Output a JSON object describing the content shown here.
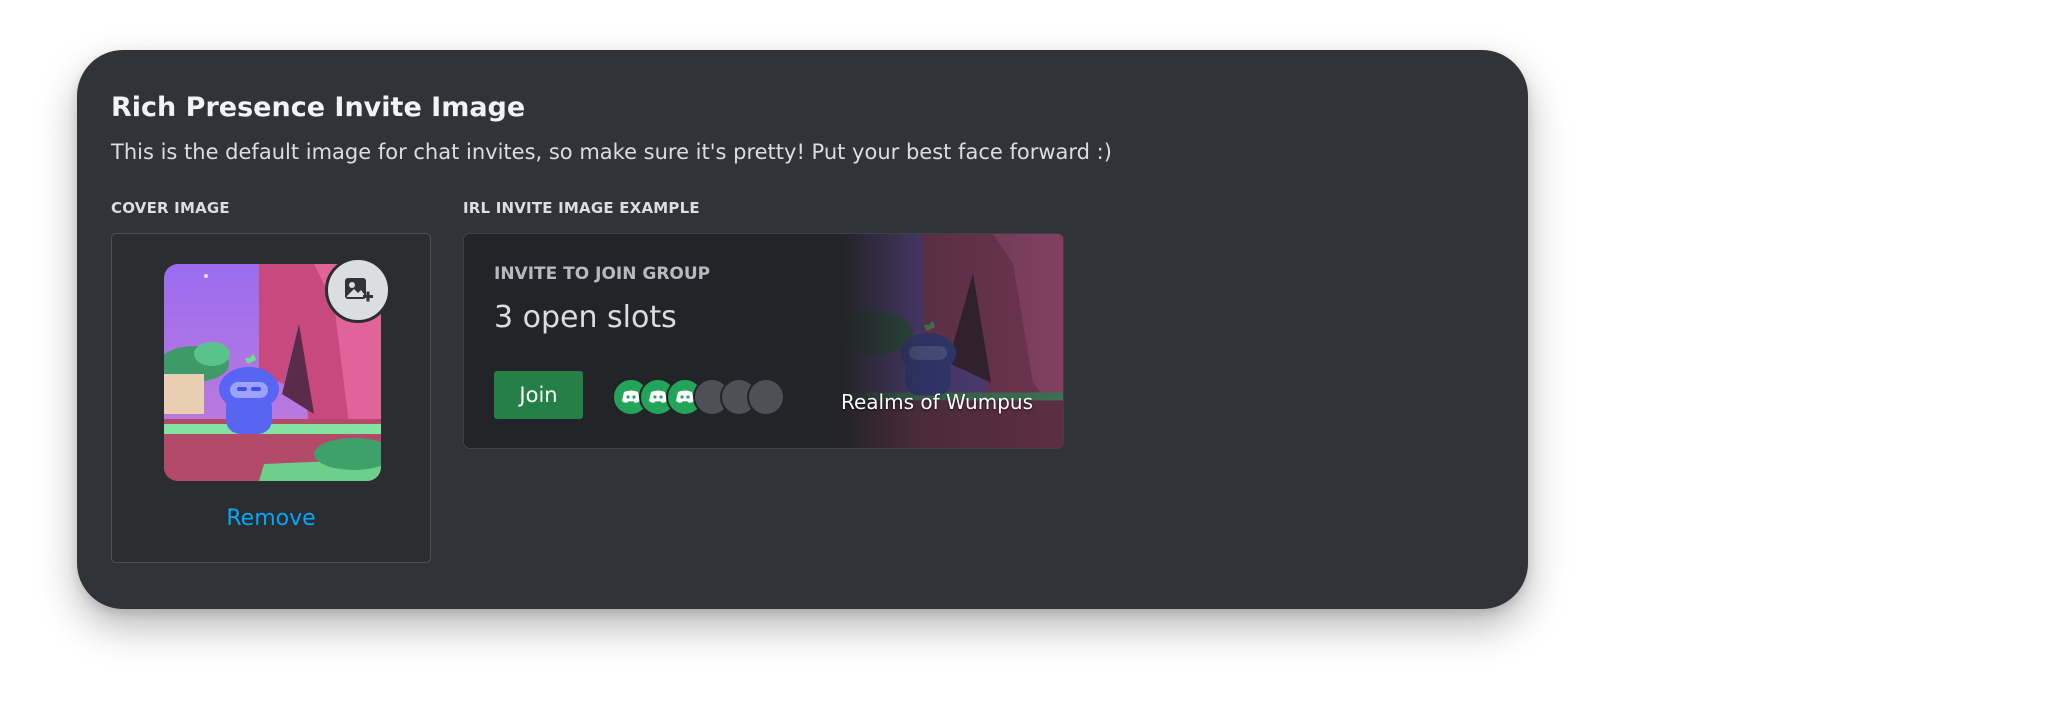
{
  "section": {
    "title": "Rich Presence Invite Image",
    "description": "This is the default image for chat invites, so make sure it's pretty! Put your best face forward :)"
  },
  "cover": {
    "label": "COVER IMAGE",
    "remove_label": "Remove",
    "add_image_icon": "image-add-icon"
  },
  "example": {
    "label": "IRL INVITE IMAGE EXAMPLE",
    "heading": "INVITE TO JOIN GROUP",
    "slots_text": "3 open slots",
    "join_label": "Join",
    "game_name": "Realms of Wumpus",
    "avatars": {
      "filled": 3,
      "empty": 3
    }
  },
  "colors": {
    "card_bg": "#313338",
    "link": "#00a8fc",
    "join_button": "#248046",
    "avatar_filled": "#23a559",
    "avatar_empty": "#4e5058"
  }
}
